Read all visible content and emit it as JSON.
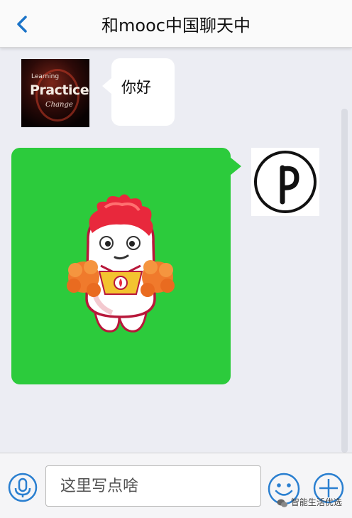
{
  "header": {
    "title": "和mooc中国聊天中",
    "back_icon": "chevron-left-icon"
  },
  "messages": [
    {
      "side": "left",
      "avatar": {
        "icon": "practice-avatar",
        "line1": "Learning",
        "line2": "Practice",
        "line3": "Change"
      },
      "text": "你好"
    },
    {
      "side": "right",
      "content": "sticker-mascot",
      "avatar": {
        "icon": "pinterest-icon"
      }
    }
  ],
  "input_bar": {
    "placeholder": "这里写点啥",
    "mic_icon": "microphone-icon",
    "emoji_icon": "smiley-icon",
    "plus_icon": "plus-icon"
  },
  "watermark": {
    "text": "智能生活优选"
  },
  "colors": {
    "accent": "#1a73c8",
    "sent_bubble": "#2ccb3c",
    "chat_background": "#ecedf3"
  }
}
